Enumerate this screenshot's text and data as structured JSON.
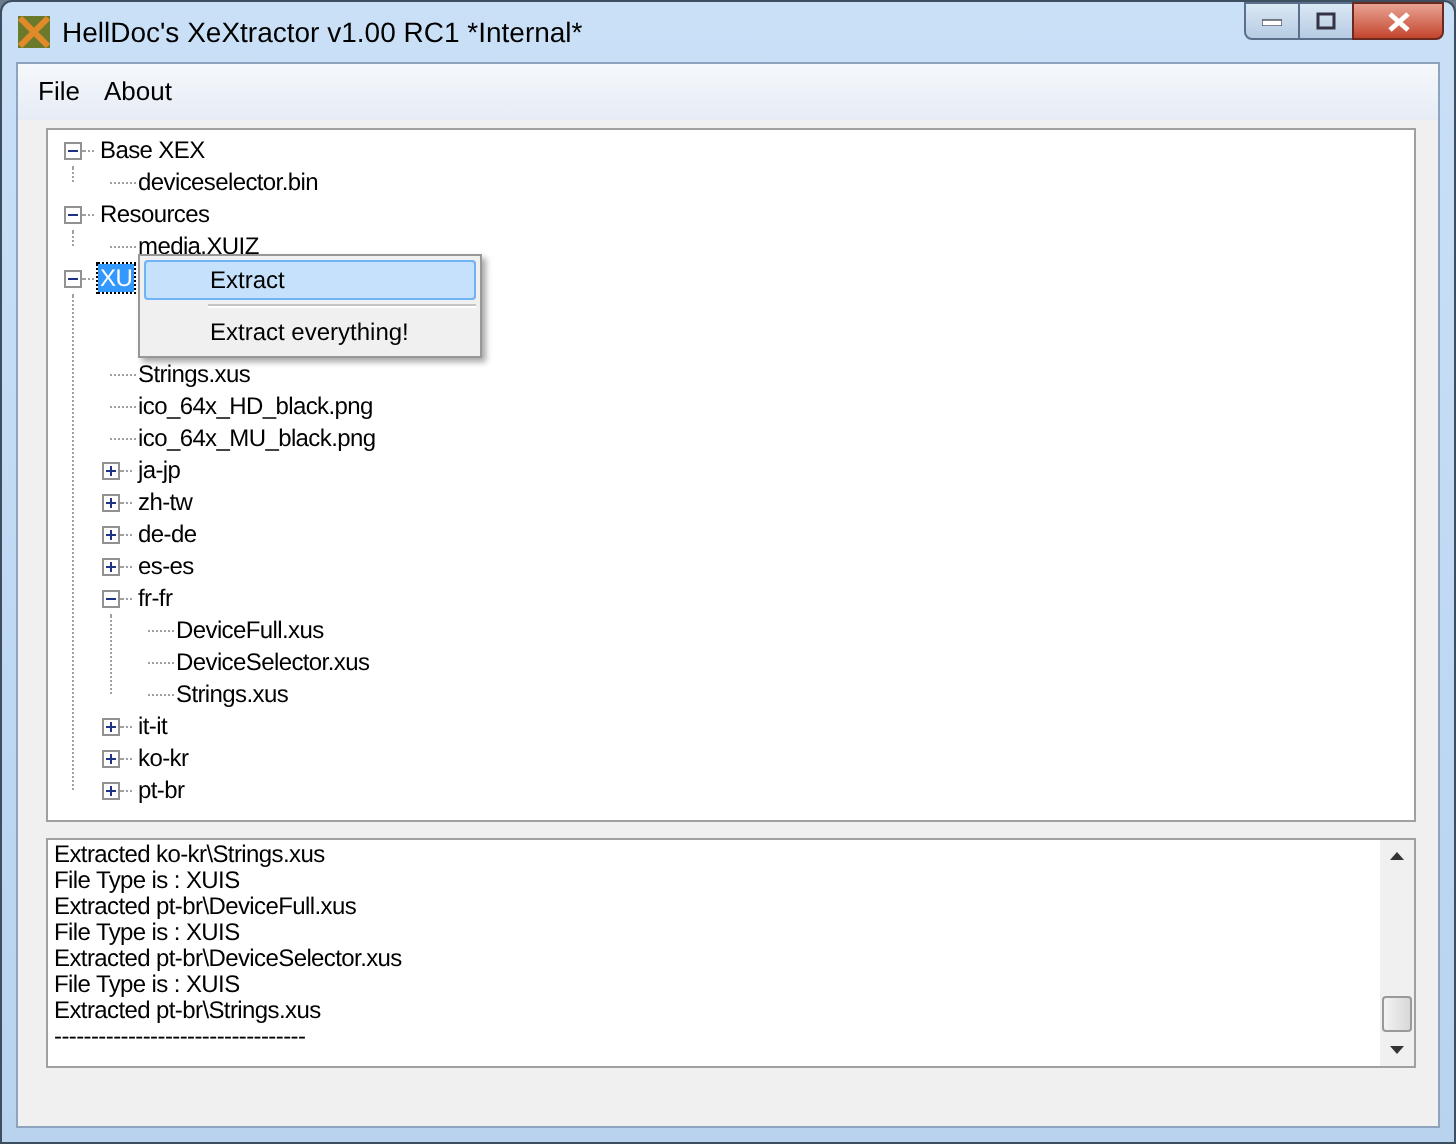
{
  "window": {
    "title": "HellDoc's XeXtractor v1.00 RC1 *Internal*"
  },
  "menu": [
    "File",
    "About"
  ],
  "tree": [
    {
      "label": "Base XEX",
      "expanded": true,
      "selected": false,
      "children": [
        {
          "label": "deviceselector.bin"
        }
      ]
    },
    {
      "label": "Resources",
      "expanded": true,
      "selected": false,
      "children": [
        {
          "label": "media.XUIZ"
        }
      ]
    },
    {
      "label": "XU",
      "expanded": true,
      "selected": true,
      "children": [
        {
          "label": "Strings.xus"
        },
        {
          "label": "ico_64x_HD_black.png"
        },
        {
          "label": "ico_64x_MU_black.png"
        },
        {
          "label": "ja-jp",
          "expanded": false
        },
        {
          "label": "zh-tw",
          "expanded": false
        },
        {
          "label": "de-de",
          "expanded": false
        },
        {
          "label": "es-es",
          "expanded": false
        },
        {
          "label": "fr-fr",
          "expanded": true,
          "children": [
            {
              "label": "DeviceFull.xus"
            },
            {
              "label": "DeviceSelector.xus"
            },
            {
              "label": "Strings.xus"
            }
          ]
        },
        {
          "label": "it-it",
          "expanded": false
        },
        {
          "label": "ko-kr",
          "expanded": false
        },
        {
          "label": "pt-br",
          "expanded": false
        }
      ]
    }
  ],
  "context_menu": [
    {
      "label": "Extract",
      "selected": true
    },
    {
      "label": "Extract everything!",
      "selected": false
    }
  ],
  "log": [
    "Extracted ko-kr\\Strings.xus",
    "File Type is : XUIS",
    "Extracted pt-br\\DeviceFull.xus",
    "File Type is : XUIS",
    "Extracted pt-br\\DeviceSelector.xus",
    "File Type is : XUIS",
    "Extracted pt-br\\Strings.xus",
    "----------------------------------"
  ]
}
